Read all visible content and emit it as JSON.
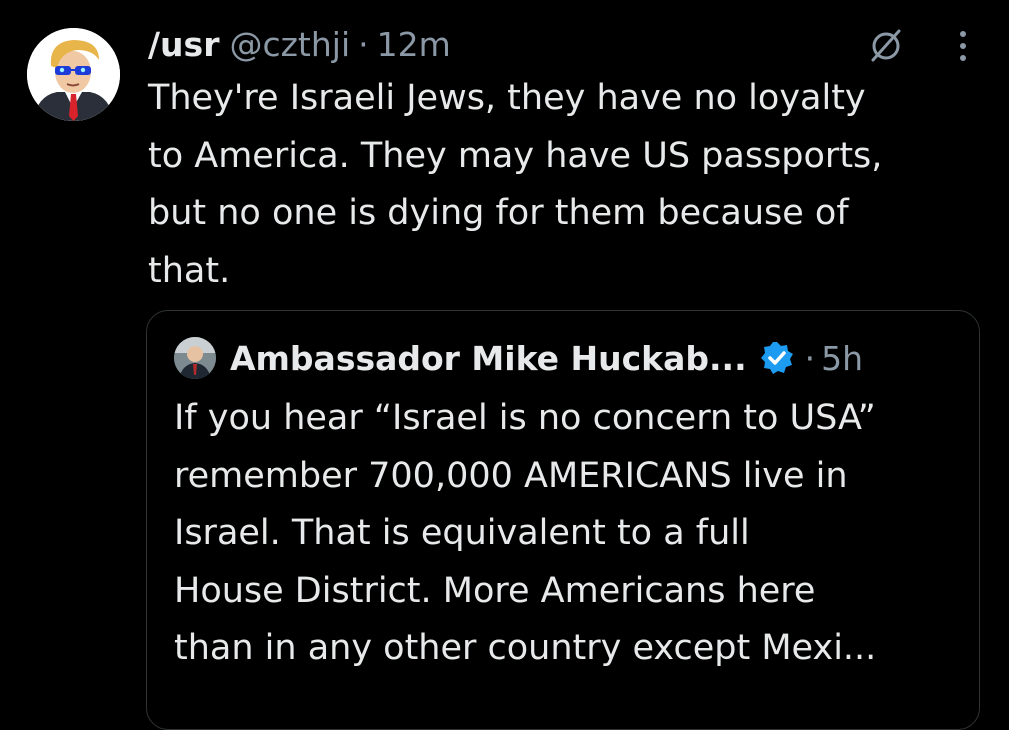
{
  "post": {
    "display_name": "/usr",
    "handle": "@czthji",
    "separator": "·",
    "time": "12m",
    "text": "They're Israeli Jews, they have no loyalty\nto America. They may have US passports,\nbut no one is dying for them because of\nthat.",
    "avatar_icon": "cartoon-man-avatar",
    "grok_icon": "grok-icon",
    "more_icon": "more-dots-icon"
  },
  "quote": {
    "display_name": "Ambassador Mike Huckab...",
    "separator": "·",
    "time": "5h",
    "verified_icon": "verified-badge-icon",
    "verified_color": "#1d9bf0",
    "text": "If you hear “Israel is no concern to USA”\nremember 700,000 AMERICANS live in\nIsrael.  That is equivalent to a full\nHouse District.  More Americans here\nthan in any other country except Mexi..."
  },
  "colors": {
    "background": "#000000",
    "primary_text": "#e7e9ea",
    "secondary_text": "#8b98a5",
    "border": "#2f3336"
  }
}
